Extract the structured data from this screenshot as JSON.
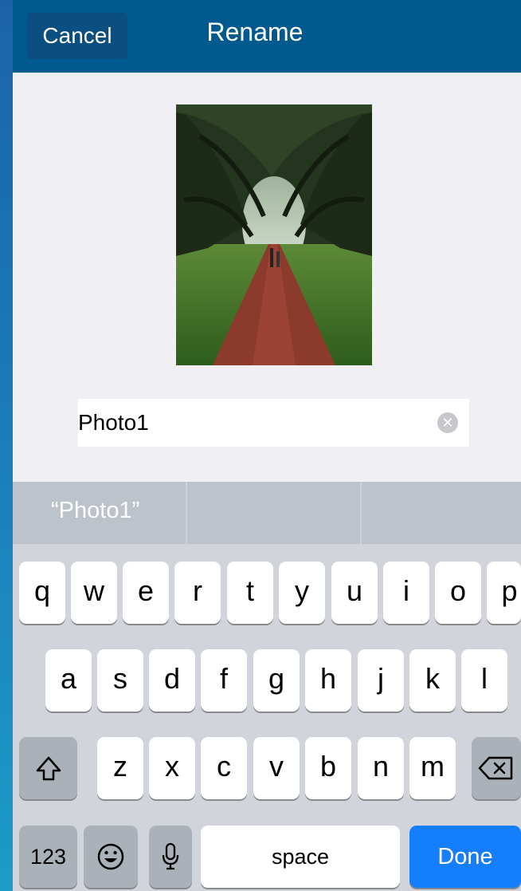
{
  "navbar": {
    "cancel_label": "Cancel",
    "title": "Rename"
  },
  "photo": {
    "alt": "Photo1"
  },
  "name_field": {
    "value": "Photo1",
    "clear_icon": "clear-circle-icon"
  },
  "keyboard": {
    "prediction": "“Photo1”",
    "row1": [
      "q",
      "w",
      "e",
      "r",
      "t",
      "y",
      "u",
      "i",
      "o",
      "p"
    ],
    "row2": [
      "a",
      "s",
      "d",
      "f",
      "g",
      "h",
      "j",
      "k",
      "l"
    ],
    "row3": [
      "z",
      "x",
      "c",
      "v",
      "b",
      "n",
      "m"
    ],
    "numbers_label": "123",
    "space_label": "space",
    "done_label": "Done",
    "icons": {
      "shift": "shift-icon",
      "backspace": "backspace-icon",
      "emoji": "emoji-icon",
      "mic": "microphone-icon"
    }
  },
  "colors": {
    "navbar": "#00598f",
    "done": "#147efb",
    "sheet": "#efeff4"
  }
}
